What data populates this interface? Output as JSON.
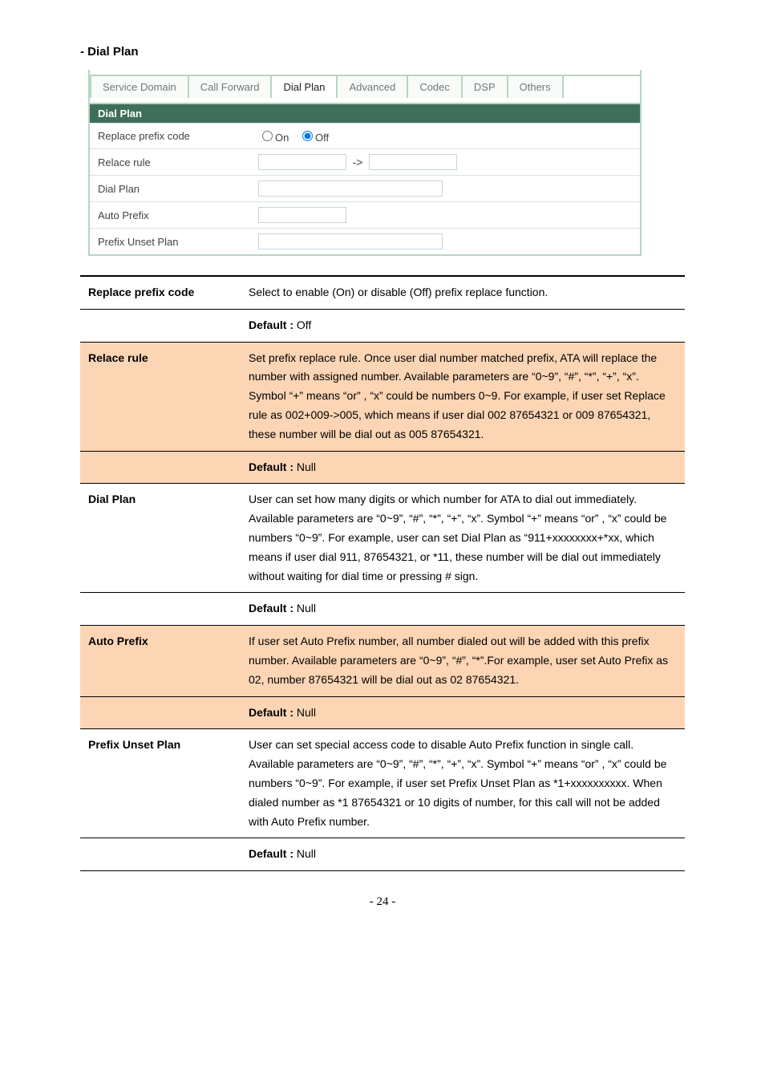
{
  "heading": "- Dial Plan",
  "ui": {
    "tabs": [
      "Service Domain",
      "Call Forward",
      "Dial Plan",
      "Advanced",
      "Codec",
      "DSP",
      "Others"
    ],
    "active_tab": "Dial Plan",
    "section_title": "Dial Plan",
    "rows": {
      "replace_prefix_code": {
        "label": "Replace prefix code",
        "opt_on": "On",
        "opt_off": "Off"
      },
      "relace_rule": {
        "label": "Relace rule",
        "arrow": "->"
      },
      "dial_plan": {
        "label": "Dial Plan"
      },
      "auto_prefix": {
        "label": "Auto Prefix"
      },
      "prefix_unset_plan": {
        "label": "Prefix Unset Plan"
      }
    }
  },
  "desc": {
    "replace_prefix_code": {
      "key": "Replace prefix code",
      "body": "Select to enable (On) or disable (Off) prefix replace function.",
      "default_label": "Default :",
      "default_value": "Off"
    },
    "relace_rule": {
      "key": "Relace rule",
      "body": "Set prefix replace rule. Once user dial number matched prefix, ATA will replace the number with assigned number. Available parameters are “0~9”, “#”, “*”, “+”, “x”. Symbol “+” means “or” , “x” could be numbers 0~9. For example, if user set Replace rule as 002+009->005, which means if user dial 002 87654321 or 009 87654321, these number will be dial out as 005 87654321.",
      "default_label": "Default :",
      "default_value": "Null"
    },
    "dial_plan": {
      "key": "Dial Plan",
      "body": "User can set how many digits or which number for ATA to dial out immediately. Available parameters are “0~9”, “#”, “*”, “+”, “x”. Symbol “+” means “or” , “x” could be numbers “0~9”. For example, user can set Dial Plan as “911+xxxxxxxx+*xx, which means if user dial 911, 87654321, or *11, these number will be dial out immediately without waiting for dial time or pressing # sign.",
      "default_label": "Default :",
      "default_value": "Null"
    },
    "auto_prefix": {
      "key": "Auto Prefix",
      "body": "If user set Auto Prefix number, all number dialed out will be added with this prefix number. Available parameters are “0~9”, “#”, “*”.For example, user set Auto Prefix as 02, number 87654321 will be dial out as 02 87654321.",
      "default_label": "Default :",
      "default_value": "Null"
    },
    "prefix_unset_plan": {
      "key": "Prefix Unset Plan",
      "body": "User can set special access code to disable Auto Prefix function in single call. Available parameters are “0~9”, “#”, “*”, “+”, “x”. Symbol “+” means “or” , “x” could be numbers “0~9”. For example, if user set Prefix Unset Plan as *1+xxxxxxxxxx. When dialed number as *1 87654321 or 10 digits of number, for this call will not be added with Auto Prefix number.",
      "default_label": "Default :",
      "default_value": "Null"
    }
  },
  "footer": "- 24 -"
}
